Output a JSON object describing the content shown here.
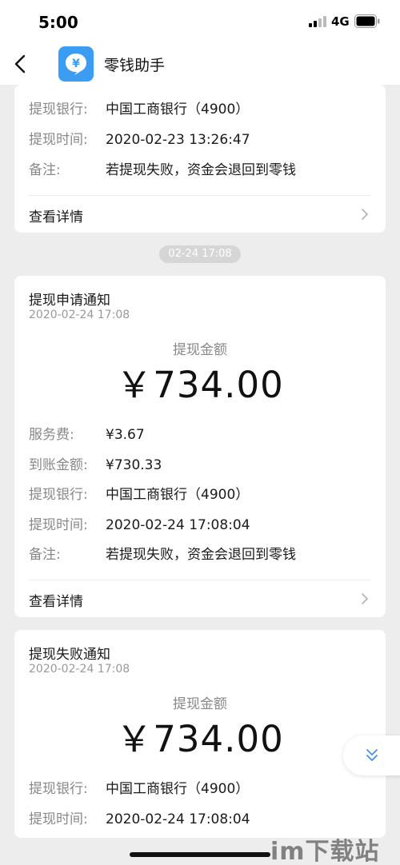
{
  "status_bar": {
    "time": "5:00",
    "network": "4G"
  },
  "nav": {
    "title": "零钱助手",
    "avatar_symbol": "¥"
  },
  "card_top": {
    "rows": [
      {
        "label": "提现银行:",
        "value": "中国工商银行（4900）"
      },
      {
        "label": "提现时间:",
        "value": "2020-02-23 13:26:47"
      },
      {
        "label": "备注:",
        "value": "若提现失败，资金会退回到零钱"
      }
    ],
    "details_label": "查看详情"
  },
  "time_pill": "02-24 17:08",
  "card_apply": {
    "title": "提现申请通知",
    "date": "2020-02-24 17:08",
    "amount_label": "提现金额",
    "amount": "￥734.00",
    "rows": [
      {
        "label": "服务费:",
        "value": "¥3.67"
      },
      {
        "label": "到账金额:",
        "value": "¥730.33"
      },
      {
        "label": "提现银行:",
        "value": "中国工商银行（4900）"
      },
      {
        "label": "提现时间:",
        "value": "2020-02-24 17:08:04"
      },
      {
        "label": "备注:",
        "value": "若提现失败，资金会退回到零钱"
      }
    ],
    "details_label": "查看详情"
  },
  "card_fail": {
    "title": "提现失败通知",
    "date": "2020-02-24 17:08",
    "amount_label": "提现金额",
    "amount": "￥734.00",
    "rows": [
      {
        "label": "提现银行:",
        "value": "中国工商银行（4900）"
      },
      {
        "label": "提现时间:",
        "value": "2020-02-24 17:08:04"
      }
    ]
  },
  "watermark": "im下载站",
  "colors": {
    "accent": "#3c9cf2",
    "background": "#ededed",
    "card": "#ffffff",
    "label_gray": "#888888"
  }
}
